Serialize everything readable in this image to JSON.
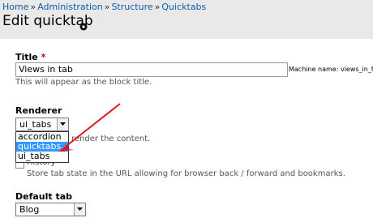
{
  "breadcrumb": [
    "Home",
    "Administration",
    "Structure",
    "Quicktabs"
  ],
  "breadcrumb_sep": "»",
  "page_title": "Edit quicktab",
  "title_field": {
    "label": "Title",
    "required_marker": "*",
    "value": "Views in tab",
    "machine_name": "Machine name: views_in_tab",
    "description": "This will appear as the block title."
  },
  "renderer": {
    "label": "Renderer",
    "selected": "ui_tabs",
    "options": [
      "accordion",
      "quicktabs",
      "ui_tabs"
    ],
    "highlighted": "quicktabs",
    "description_fragment": "render the content."
  },
  "history": {
    "label": "History",
    "checked": false,
    "description": "Store tab state in the URL allowing for browser back / forward and bookmarks."
  },
  "default_tab": {
    "label": "Default tab",
    "selected": "Blog"
  },
  "colors": {
    "header_bg": "#e9e9e9",
    "link": "#0b5ea8",
    "highlight": "#3399ff",
    "arrow": "#e0141e",
    "required": "#cc0000"
  },
  "icons": {
    "page_action": "gear-icon",
    "select_arrow": "chevron-down-icon",
    "annotation": "red-arrow"
  }
}
